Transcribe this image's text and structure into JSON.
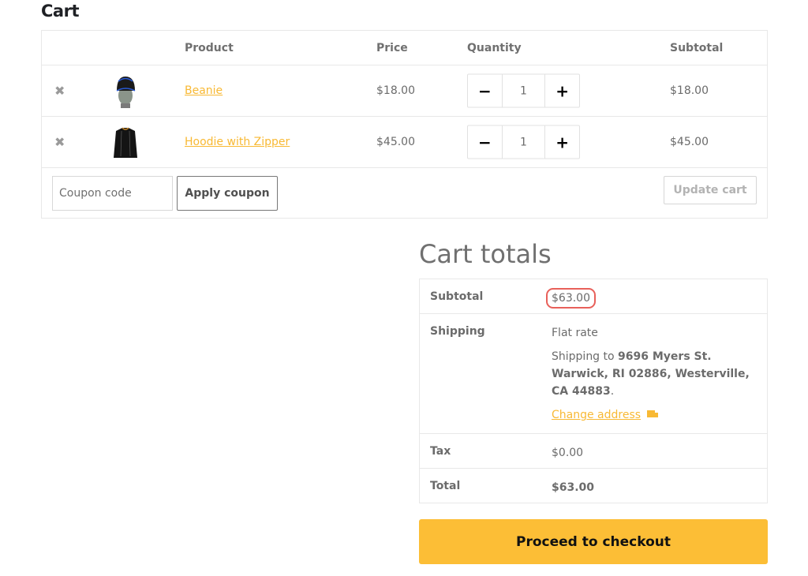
{
  "page": {
    "title": "Cart"
  },
  "cart_table": {
    "headers": {
      "product": "Product",
      "price": "Price",
      "quantity": "Quantity",
      "subtotal": "Subtotal"
    },
    "items": [
      {
        "remove_icon": "✖",
        "image": "beanie-thumbnail",
        "name": "Beanie",
        "price": "$18.00",
        "quantity": "1",
        "subtotal": "$18.00"
      },
      {
        "remove_icon": "✖",
        "image": "hoodie-thumbnail",
        "name": "Hoodie with Zipper",
        "price": "$45.00",
        "quantity": "1",
        "subtotal": "$45.00"
      }
    ],
    "qty_minus": "−",
    "qty_plus": "+",
    "coupon_placeholder": "Coupon code",
    "apply_coupon_label": "Apply coupon",
    "update_cart_label": "Update cart"
  },
  "totals": {
    "title": "Cart totals",
    "subtotal_label": "Subtotal",
    "subtotal_value": "$63.00",
    "shipping_label": "Shipping",
    "shipping_method": "Flat rate",
    "shipping_to_prefix": "Shipping to ",
    "shipping_address": "9696 Myers St. Warwick, RI 02886, Westerville, CA 44883",
    "shipping_to_suffix": ".",
    "change_address_label": "Change address",
    "tax_label": "Tax",
    "tax_value": "$0.00",
    "total_label": "Total",
    "total_value": "$63.00"
  },
  "checkout": {
    "label": "Proceed to checkout"
  },
  "colors": {
    "accent": "#f8b934",
    "checkout_bg": "#fcbe36",
    "highlight_ring": "#e8605a"
  }
}
